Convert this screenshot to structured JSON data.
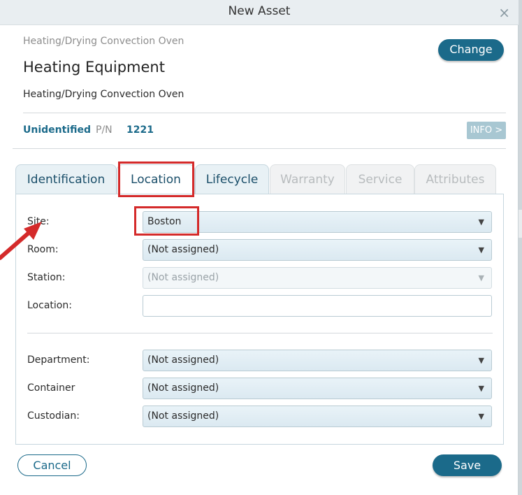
{
  "dialog": {
    "title": "New Asset",
    "close_symbol": "×"
  },
  "asset": {
    "category": "Heating/Drying Convection Oven",
    "name": "Heating Equipment",
    "description": "Heating/Drying Convection Oven",
    "status": "Unidentified",
    "pn_label": "P/N",
    "pn_value": "1221"
  },
  "buttons": {
    "change": "Change",
    "info": "INFO >",
    "cancel": "Cancel",
    "save": "Save"
  },
  "tabs": [
    {
      "label": "Identification",
      "state": "normal"
    },
    {
      "label": "Location",
      "state": "active"
    },
    {
      "label": "Lifecycle",
      "state": "normal"
    },
    {
      "label": "Warranty",
      "state": "disabled"
    },
    {
      "label": "Service",
      "state": "disabled"
    },
    {
      "label": "Attributes",
      "state": "disabled"
    }
  ],
  "fields": {
    "site": {
      "label": "Site:",
      "value": "Boston"
    },
    "room": {
      "label": "Room:",
      "value": "(Not assigned)"
    },
    "station": {
      "label": "Station:",
      "value": "(Not assigned)"
    },
    "location": {
      "label": "Location:",
      "value": ""
    },
    "department": {
      "label": "Department:",
      "value": "(Not assigned)"
    },
    "container": {
      "label": "Container",
      "value": "(Not assigned)"
    },
    "custodian": {
      "label": "Custodian:",
      "value": "(Not assigned)"
    }
  },
  "icons": {
    "caret": "▼"
  },
  "colors": {
    "accent": "#1b6a8a",
    "highlight": "#d42a2a"
  }
}
